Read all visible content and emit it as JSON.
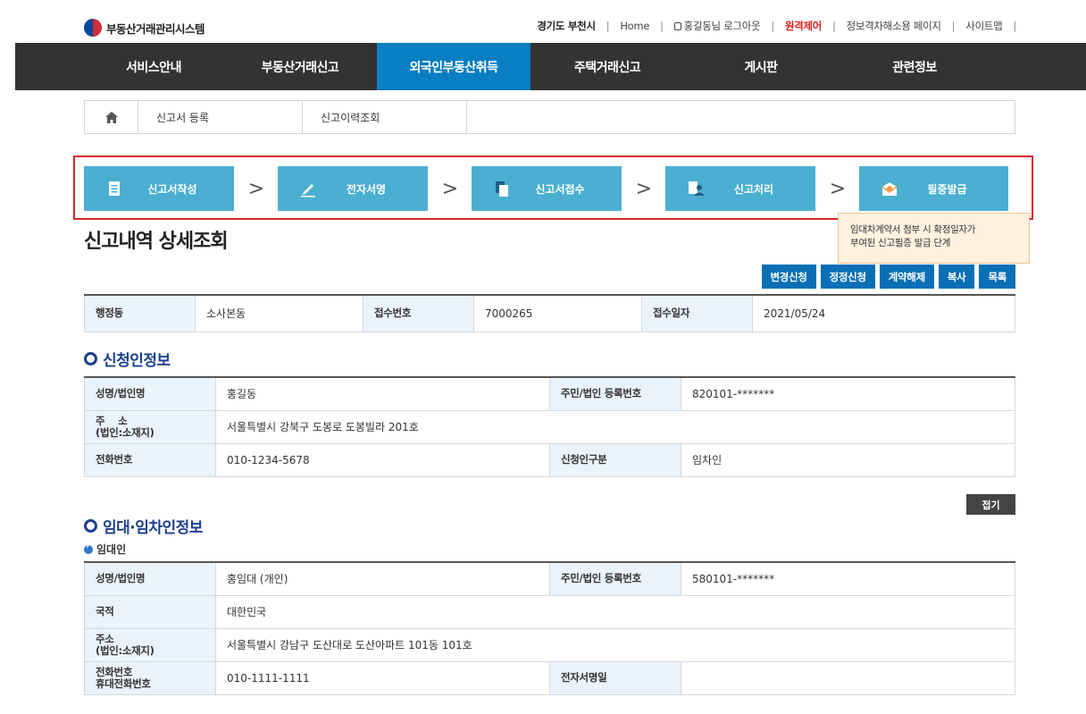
{
  "header": {
    "logo_text": "부동산거래관리시스템",
    "util": {
      "region": "경기도 부천시",
      "home": "Home",
      "logout": "홍길동님 로그아웃",
      "remote": "원격제어",
      "privacy_page": "정보격차해소용 페이지",
      "sitemap": "사이트맵"
    }
  },
  "gnb": {
    "items": [
      {
        "label": "서비스안내"
      },
      {
        "label": "부동산거래신고"
      },
      {
        "label": "외국인부동산취득"
      },
      {
        "label": "주택거래신고"
      },
      {
        "label": "게시판"
      },
      {
        "label": "관련정보"
      }
    ],
    "active_index": 2
  },
  "subtabs": {
    "items": [
      {
        "label": "신고서 등록"
      },
      {
        "label": "신고이력조회"
      }
    ]
  },
  "steps": [
    {
      "label": "신고서작성",
      "icon": "document-icon"
    },
    {
      "label": "전자서명",
      "icon": "pen-icon"
    },
    {
      "label": "신고서접수",
      "icon": "files-icon"
    },
    {
      "label": "신고처리",
      "icon": "user-doc-icon"
    },
    {
      "label": "필증발급",
      "icon": "mail-icon"
    }
  ],
  "tooltip": {
    "line1": "임대차계약서 첨부 시 확정일자가",
    "line2": "부여된 신고필증 발급 단계"
  },
  "page_title": "신고내역 상세조회",
  "actions": {
    "change": "변경신청",
    "correct": "정정신청",
    "cancel": "계약해제",
    "copy": "복사",
    "list": "목록"
  },
  "summary": {
    "dong_label": "행정동",
    "dong_value": "소사본동",
    "receipt_no_label": "접수번호",
    "receipt_no_value": "7000265",
    "receipt_date_label": "접수일자",
    "receipt_date_value": "2021/05/24"
  },
  "applicant": {
    "title": "신청인정보",
    "name_label": "성명/법인명",
    "name_value": "홍길동",
    "id_label": "주민/법인 등록번호",
    "id_value": "820101-*******",
    "addr_label_1": "주    소",
    "addr_label_2": "(법인:소재지)",
    "addr_value": "서울특별시 강북구 도봉로 도봉빌라 201호",
    "phone_label": "전화번호",
    "phone_value": "010-1234-5678",
    "type_label": "신청인구분",
    "type_value": "임차인"
  },
  "fold_label": "접기",
  "lease": {
    "title": "임대·임차인정보",
    "subtitle": "임대인",
    "name_label": "성명/법인명",
    "name_value": "홍임대 (개인)",
    "id_label": "주민/법인 등록번호",
    "id_value": "580101-*******",
    "nation_label": "국적",
    "nation_value": "대한민국",
    "addr_label_1": "주소",
    "addr_label_2": "(법인:소재지)",
    "addr_value": "서울특별시 강남구 도산대로 도산아파트 101동 101호",
    "phone_label_1": "전화번호",
    "phone_label_2": "휴대전화번호",
    "phone_value": "010-1111-1111",
    "esign_label": "전자서명일",
    "esign_value": ""
  }
}
